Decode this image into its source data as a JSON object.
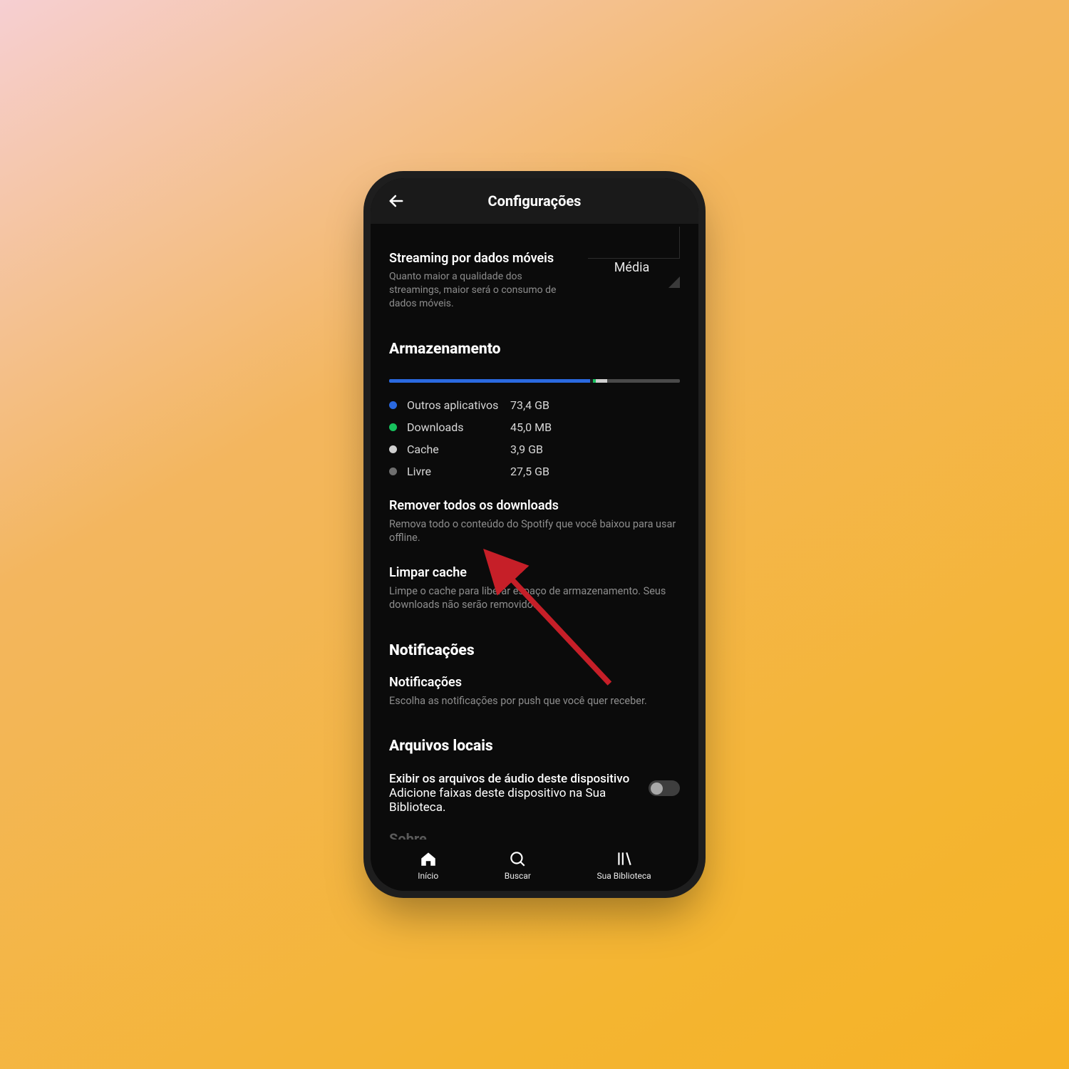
{
  "header": {
    "title": "Configurações"
  },
  "streaming": {
    "title": "Streaming por dados móveis",
    "desc": "Quanto maior a qualidade dos streamings, maior será o consumo de dados móveis.",
    "value": "Média"
  },
  "storage": {
    "heading": "Armazenamento",
    "legend": [
      {
        "name": "Outros aplicativos",
        "value": "73,4 GB",
        "color": "#2a69e0"
      },
      {
        "name": "Downloads",
        "value": "45,0 MB",
        "color": "#17c15d"
      },
      {
        "name": "Cache",
        "value": "3,9 GB",
        "color": "#cfcfcf"
      },
      {
        "name": "Livre",
        "value": "27,5 GB",
        "color": "#6f6f6f"
      }
    ]
  },
  "remove_downloads": {
    "title": "Remover todos os downloads",
    "desc": "Remova todo o conteúdo do Spotify que você baixou para usar offline."
  },
  "clear_cache": {
    "title": "Limpar cache",
    "desc": "Limpe o cache para liberar espaço de armazenamento. Seus downloads não serão removidos."
  },
  "notifications": {
    "heading": "Notificações",
    "title": "Notificações",
    "desc": "Escolha as notificações por push que você quer receber."
  },
  "local_files": {
    "heading": "Arquivos locais",
    "title": "Exibir os arquivos de áudio deste dispositivo",
    "desc": "Adicione faixas deste dispositivo na Sua Biblioteca.",
    "toggle": false
  },
  "about": {
    "heading": "Sobre"
  },
  "nav": {
    "home": "Início",
    "search": "Buscar",
    "library": "Sua Biblioteca"
  },
  "arrow": {
    "color": "#c61f28"
  }
}
